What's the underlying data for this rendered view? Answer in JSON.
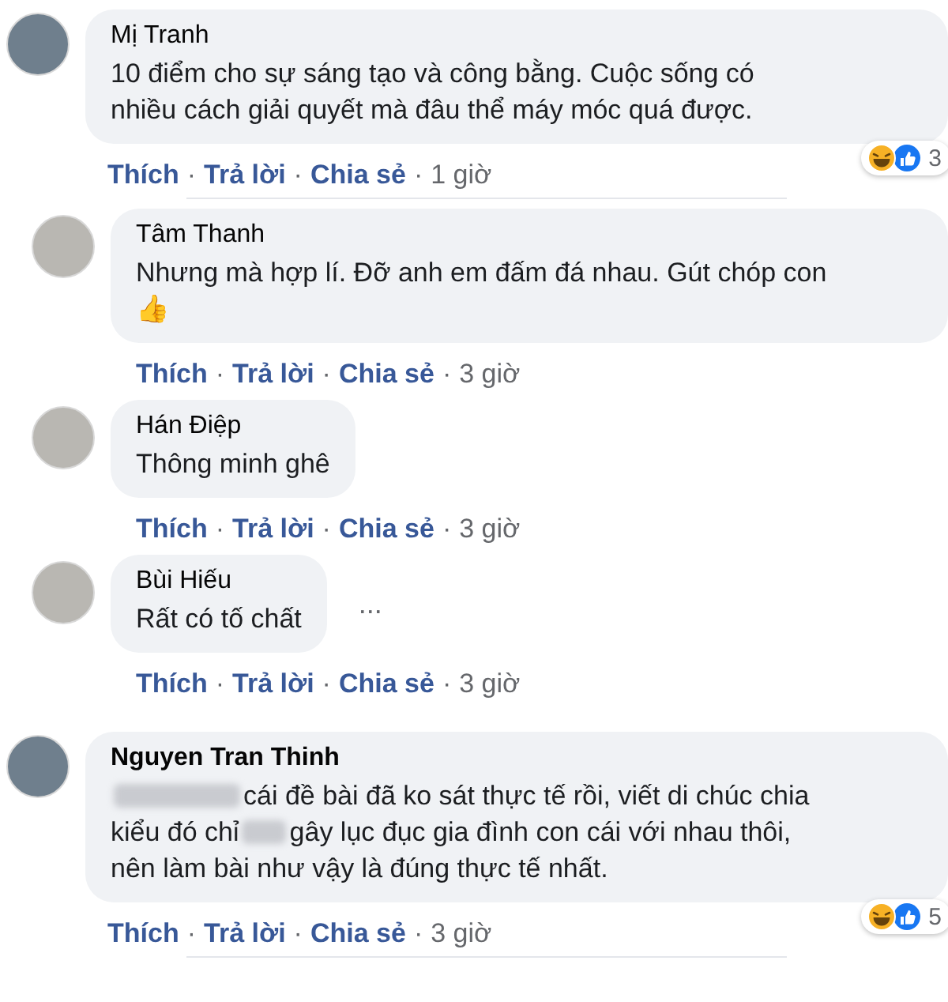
{
  "comments": [
    {
      "kind": "top",
      "author": "Mị Tranh",
      "lines": [
        [
          {
            "kind": "text",
            "text": "10 điểm cho sự sáng tạo và công bằng. Cuộc sống có"
          }
        ],
        [
          {
            "kind": "text",
            "text": "nhiều cách giải quyết mà đâu thể máy móc quá được."
          }
        ]
      ],
      "reactions": {
        "count": "3"
      },
      "actions": [
        "Thích",
        "Trả lời",
        "Chia sẻ"
      ],
      "separator": "·",
      "time": "1 giờ"
    },
    {
      "kind": "reply",
      "author": "Tâm Thanh",
      "lines": [
        [
          {
            "kind": "text",
            "text": "Nhưng mà hợp lí. Đỡ anh em đấm đá nhau. Gút chóp con"
          }
        ],
        [
          {
            "kind": "text",
            "text": "👍"
          }
        ]
      ],
      "actions": [
        "Thích",
        "Trả lời",
        "Chia sẻ"
      ],
      "separator": "·",
      "time": "3 giờ"
    },
    {
      "kind": "reply",
      "author": "Hán Điệp",
      "lines": [
        [
          {
            "kind": "text",
            "text": "Thông minh ghê"
          }
        ]
      ],
      "actions": [
        "Thích",
        "Trả lời",
        "Chia sẻ"
      ],
      "separator": "·",
      "time": "3 giờ"
    },
    {
      "kind": "reply",
      "author": "Bùi Hiếu",
      "lines": [
        [
          {
            "kind": "text",
            "text": "Rất có tố chất"
          }
        ]
      ],
      "actions": [
        "Thích",
        "Trả lời",
        "Chia sẻ"
      ],
      "separator": "·",
      "time": "3 giờ",
      "more_label": "..."
    },
    {
      "kind": "top",
      "author": "Nguyen Tran Thinh",
      "lines": [
        [
          {
            "kind": "blur"
          },
          {
            "kind": "text",
            "text": "cái đề bài đã ko sát thực tế rồi, viết di chúc chia"
          }
        ],
        [
          {
            "kind": "text",
            "text": "kiểu đó chỉ"
          },
          {
            "kind": "blur"
          },
          {
            "kind": "text",
            "text": "gây lục đục gia đình con cái với nhau thôi,"
          }
        ],
        [
          {
            "kind": "text",
            "text": "nên làm bài như vậy là đúng thực tế nhất."
          }
        ]
      ],
      "reactions": {
        "count": "5"
      },
      "actions": [
        "Thích",
        "Trả lời",
        "Chia sẻ"
      ],
      "separator": "·",
      "time": "3 giờ"
    }
  ]
}
